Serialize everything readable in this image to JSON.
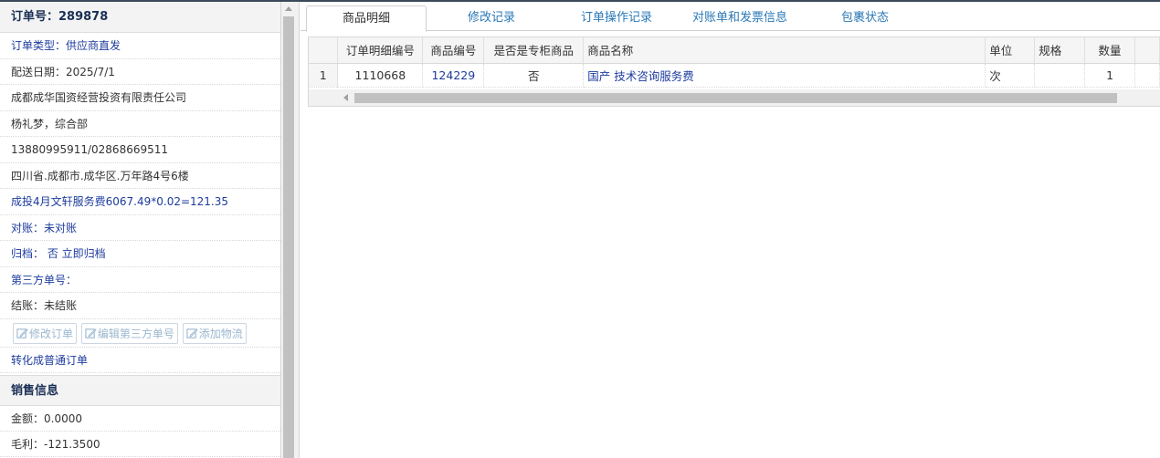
{
  "order": {
    "title": "订单号：289878",
    "fields": [
      {
        "text": "订单类型：供应商直发",
        "style": "blue"
      },
      {
        "text": "配送日期：2025/7/1",
        "style": "dark"
      },
      {
        "text": "成都成华国资经营投资有限责任公司",
        "style": "dark"
      },
      {
        "text": "杨礼梦，综合部",
        "style": "dark"
      },
      {
        "text": "13880995911/02868669511",
        "style": "dark"
      },
      {
        "text": "四川省.成都市.成华区.万年路4号6楼",
        "style": "dark"
      },
      {
        "text": "成投4月文轩服务费6067.49*0.02=121.35",
        "style": "blue"
      },
      {
        "text": "对账：未对账",
        "style": "blue"
      },
      {
        "text": "归档： 否 立即归档",
        "style": "blue"
      },
      {
        "text": "第三方单号：",
        "style": "blue"
      },
      {
        "text": "结账：未结账",
        "style": "dark"
      }
    ],
    "buttons": {
      "edit_order": "修改订单",
      "edit_third_party": "编辑第三方单号",
      "add_logistics": "添加物流"
    },
    "convert_link": "转化成普通订单"
  },
  "sales": {
    "title": "销售信息",
    "amount": "金额：0.0000",
    "profit": "毛利：-121.3500"
  },
  "tabs": [
    {
      "label": "商品明细",
      "active": true
    },
    {
      "label": "修改记录",
      "active": false
    },
    {
      "label": "订单操作记录",
      "active": false
    },
    {
      "label": "对账单和发票信息",
      "active": false
    },
    {
      "label": "包裹状态",
      "active": false
    }
  ],
  "table": {
    "columns": [
      "",
      "订单明细编号",
      "商品编号",
      "是否是专柜商品",
      "商品名称",
      "单位",
      "规格",
      "数量"
    ],
    "rows": [
      {
        "row_num": "1",
        "detail_id": "1110668",
        "product_id": "124229",
        "is_counter": "否",
        "name": "国产 技术咨询服务费",
        "unit": "次",
        "spec": "",
        "qty": "1"
      }
    ]
  },
  "colors": {
    "link_blue": "#1d3b9e",
    "tab_blue": "#2a78b7",
    "disabled_button": "#9ab7cf"
  }
}
